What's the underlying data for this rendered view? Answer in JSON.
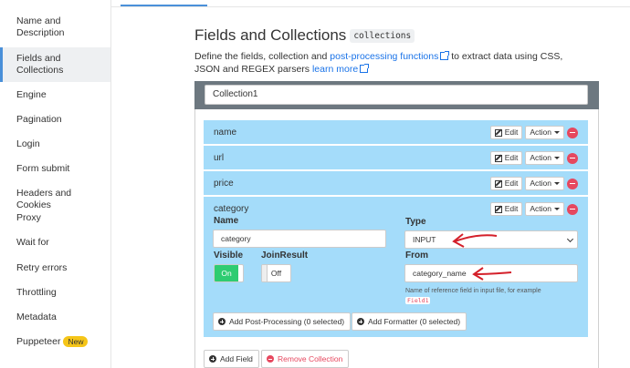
{
  "sidebar": {
    "items": [
      {
        "label": "Name and Description"
      },
      {
        "label": "Fields and Collections",
        "active": true
      },
      {
        "label": "Engine"
      },
      {
        "label": "Pagination"
      },
      {
        "label": "Login"
      },
      {
        "label": "Form submit"
      },
      {
        "label": "Headers and Cookies"
      },
      {
        "label": "Proxy"
      },
      {
        "label": "Wait for"
      },
      {
        "label": "Retry errors"
      },
      {
        "label": "Throttling"
      },
      {
        "label": "Metadata"
      },
      {
        "label": "Puppeteer",
        "badge": "New"
      }
    ]
  },
  "main": {
    "title": "Fields and Collections",
    "title_code": "collections",
    "desc_prefix": "Define the fields, collection and ",
    "desc_link1": "post-processing functions",
    "desc_mid": " to extract data using CSS, JSON and REGEX parsers ",
    "desc_link2": "learn more"
  },
  "collection": {
    "name": "Collection1",
    "fields": [
      {
        "name": "name"
      },
      {
        "name": "url"
      },
      {
        "name": "price"
      }
    ],
    "expanded_field": {
      "name": "category",
      "name_label": "Name",
      "name_value": "category",
      "type_label": "Type",
      "type_value": "INPUT",
      "visible_label": "Visible",
      "visible_value": "On",
      "joinresult_label": "JoinResult",
      "joinresult_value": "Off",
      "from_label": "From",
      "from_value": "category_name",
      "hint": "Name of reference field in input file, for example",
      "hint_code": "Field1"
    },
    "edit_label": "Edit",
    "action_label": "Action",
    "add_postprocessing": "Add Post-Processing (0 selected)",
    "add_formatter": "Add Formatter (0 selected)",
    "add_field": "Add Field",
    "remove_collection": "Remove Collection"
  },
  "colors": {
    "row_bg": "#a4dcfa",
    "accent": "#4a90d9",
    "toggle_on": "#2ecc71",
    "danger": "#e6485f",
    "annotation_arrow": "#d4202a"
  }
}
